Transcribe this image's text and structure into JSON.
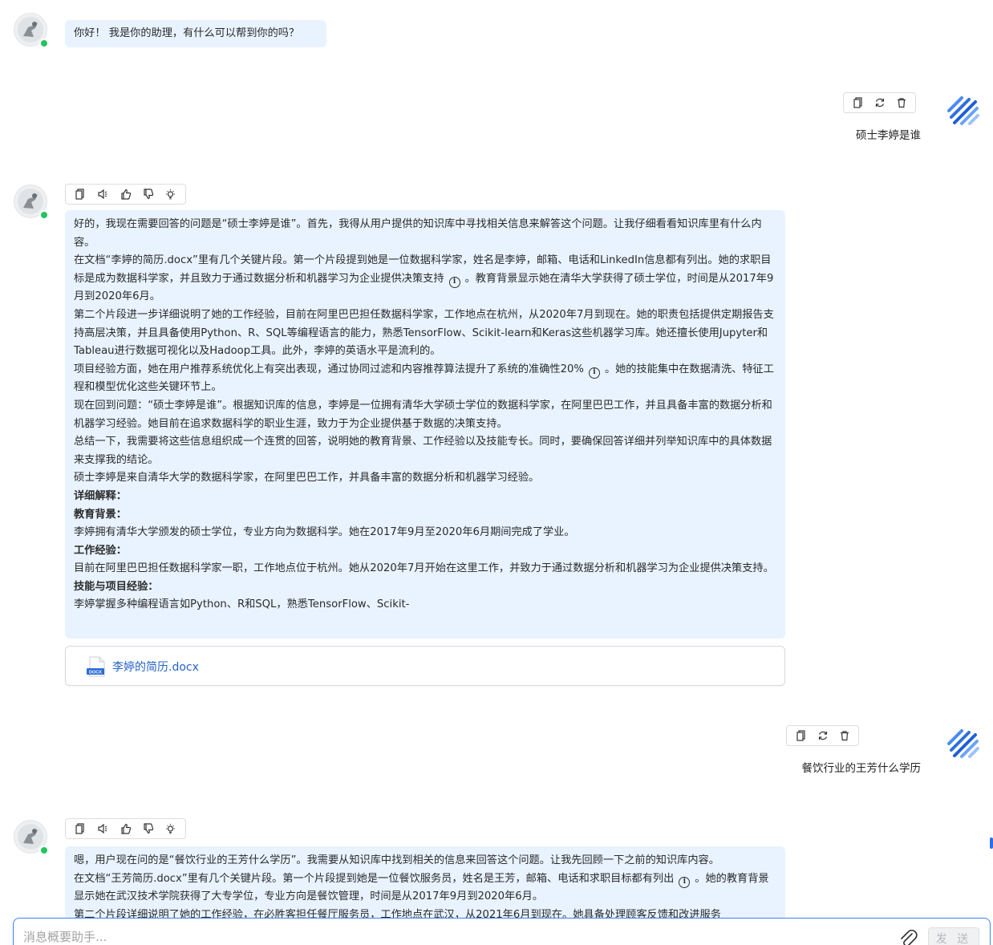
{
  "messages": {
    "greeting": "你好！ 我是你的助理，有什么可以帮到你的吗？",
    "user_q1": "硕士李婷是谁",
    "answer1": {
      "lines": [
        "好的，我现在需要回答的问题是“硕士李婷是谁”。首先，我得从用户提供的知识库中寻找相关信息来解答这个问题。让我仔细看看知识库里有什么内容。",
        "在文档“李婷的简历.docx”里有几个关键片段。第一个片段提到她是一位数据科学家，姓名是李婷，邮箱、电话和LinkedIn信息都有列出。她的求职目标是成为数据科学家，并且致力于通过数据分析和机器学习为企业提供决策支持",
        "。教育背景显示她在清华大学获得了硕士学位，时间是从2017年9月到2020年6月。",
        "第二个片段进一步详细说明了她的工作经验，目前在阿里巴巴担任数据科学家，工作地点在杭州，从2020年7月到现在。她的职责包括提供定期报告支持高层决策，并且具备使用Python、R、SQL等编程语言的能力，熟悉TensorFlow、Scikit-learn和Keras这些机器学习库。她还擅长使用Jupyter和Tableau进行数据可视化以及Hadoop工具。此外，李婷的英语水平是流利的。",
        "项目经验方面，她在用户推荐系统优化上有突出表现，通过协同过滤和内容推荐算法提升了系统的准确性20%",
        "。她的技能集中在数据清洗、特征工程和模型优化这些关键环节上。",
        "现在回到问题：“硕士李婷是谁”。根据知识库的信息，李婷是一位拥有清华大学硕士学位的数据科学家，在阿里巴巴工作，并且具备丰富的数据分析和机器学习经验。她目前在追求数据科学的职业生涯，致力于为企业提供基于数据的决策支持。",
        "总结一下，我需要将这些信息组织成一个连贯的回答，说明她的教育背景、工作经验以及技能专长。同时，要确保回答详细并列举知识库中的具体数据来支撑我的结论。",
        "硕士李婷是来自清华大学的数据科学家，在阿里巴巴工作，并具备丰富的数据分析和机器学习经验。",
        "详细解释：",
        "教育背景：",
        "李婷拥有清华大学颁发的硕士学位，专业方向为数据科学。她在2017年9月至2020年6月期间完成了学业。",
        "工作经验：",
        "目前在阿里巴巴担任数据科学家一职，工作地点位于杭州。她从2020年7月开始在这里工作，并致力于通过数据分析和机器学习为企业提供决策支持。",
        "技能与项目经验：",
        "李婷掌握多种编程语言如Python、R和SQL，熟悉TensorFlow、Scikit-"
      ],
      "cite_mark": "i",
      "file_name": "李婷的简历.docx",
      "file_badge": "DOCX"
    },
    "user_q2": "餐饮行业的王芳什么学历",
    "answer2": {
      "lines": [
        "嗯，用户现在问的是“餐饮行业的王芳什么学历”。我需要从知识库中找到相关的信息来回答这个问题。让我先回顾一下之前的知识库内容。",
        "在文档“王芳简历.docx”里有几个关键片段。第一个片段提到她是一位餐饮服务员，姓名是王芳，邮箱、电话和求职目标都有列出",
        "。她的教育背景显示她在武汉技术学院获得了大专学位，专业方向是餐饮管理，时间是从2017年9月到2020年6月。",
        "第二个片段详细说明了她的工作经验，在必胜客担任餐厅服务员，工作地点在武汉，从2021年6月到现在。她具备处理顾客反馈和改进服务"
      ]
    }
  },
  "composer": {
    "placeholder": "消息概要助手...",
    "send_label": "发 送"
  },
  "colors": {
    "bubble_bg": "#e8f3ff",
    "accent": "#3b82f6",
    "online": "#22c55e"
  },
  "icons": [
    "copy-icon",
    "refresh-icon",
    "delete-icon",
    "speaker-icon",
    "thumbs-up-icon",
    "thumbs-down-icon",
    "lightbulb-icon",
    "docx-file-icon",
    "paperclip-icon"
  ]
}
